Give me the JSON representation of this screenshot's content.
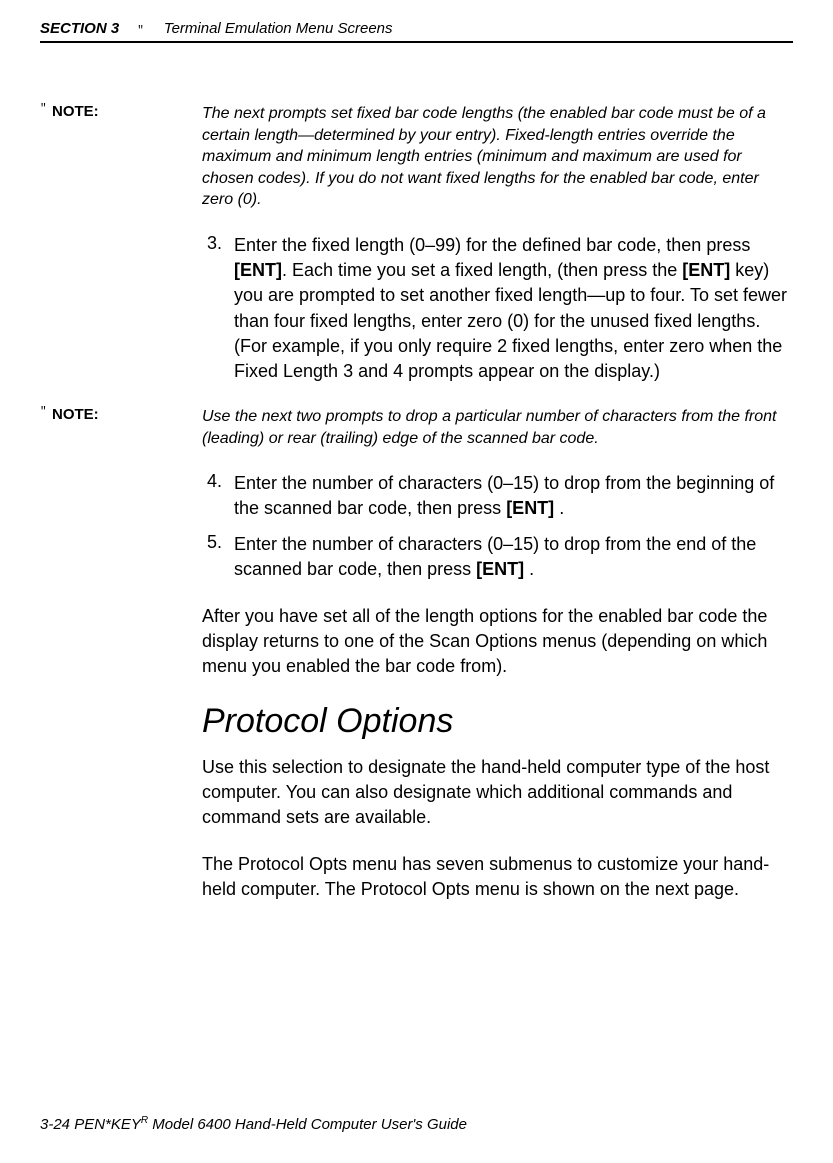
{
  "header": {
    "section_label": "SECTION 3",
    "marker": "\"",
    "title": "Terminal Emulation Menu Screens"
  },
  "notes": [
    {
      "marker": "\"",
      "label": "NOTE:",
      "text": "The next prompts set fixed bar code lengths (the enabled bar code must be of a certain length—determined by your entry).  Fixed-length entries override the maximum and minimum length entries (minimum and maximum are used for chosen codes).  If you do not want fixed lengths for the enabled bar code, enter zero (0)."
    },
    {
      "marker": "\"",
      "label": "NOTE:",
      "text": "Use the next two prompts to drop a particular number of characters from the front (leading) or rear (trailing) edge of the scanned bar code."
    }
  ],
  "steps": {
    "s3_pre": "Enter the fixed length (0–99) for the defined bar code, then press ",
    "s3_ent1": "[ENT]",
    "s3_mid1": ".  Each time you set a fixed length, (then press the ",
    "s3_ent2": "[ENT]",
    "s3_post": " key) you are prompted to set another fixed length—up to four.  To set fewer than four fixed lengths, enter zero (0) for the unused fixed lengths.  (For example, if you only require 2 fixed lengths, enter zero when the Fixed Length 3 and 4 prompts appear on the display.)",
    "s4_pre": "Enter the number of characters (0–15) to drop from the beginning of the scanned bar code, then press ",
    "s4_ent": "[ENT]",
    "s4_post": " .",
    "s5_pre": "Enter the number of characters (0–15) to drop from the end of the scanned bar code, then press ",
    "s5_ent": "[ENT]",
    "s5_post": " ."
  },
  "step_numbers": {
    "n3": "3.",
    "n4": "4.",
    "n5": "5."
  },
  "paragraphs": {
    "after_scan": "After you have set all of the length options for the enabled bar code the display returns to one of the Scan Options menus (depending on which menu you enabled the bar code from).",
    "protocol_intro": "Use this selection to designate the hand-held computer type of the host computer.  You can also designate which additional commands and command sets are available.",
    "protocol_detail": "The Protocol Opts menu has seven submenus to customize your hand-held computer.  The Protocol Opts menu is shown on the next page."
  },
  "headings": {
    "protocol_options": "Protocol Options"
  },
  "footer": {
    "page": "3-24",
    "spacer": "    ",
    "prefix": "PEN*KEY",
    "sup": "R",
    "rest": " Model 6400 Hand-Held Computer User's Guide"
  }
}
